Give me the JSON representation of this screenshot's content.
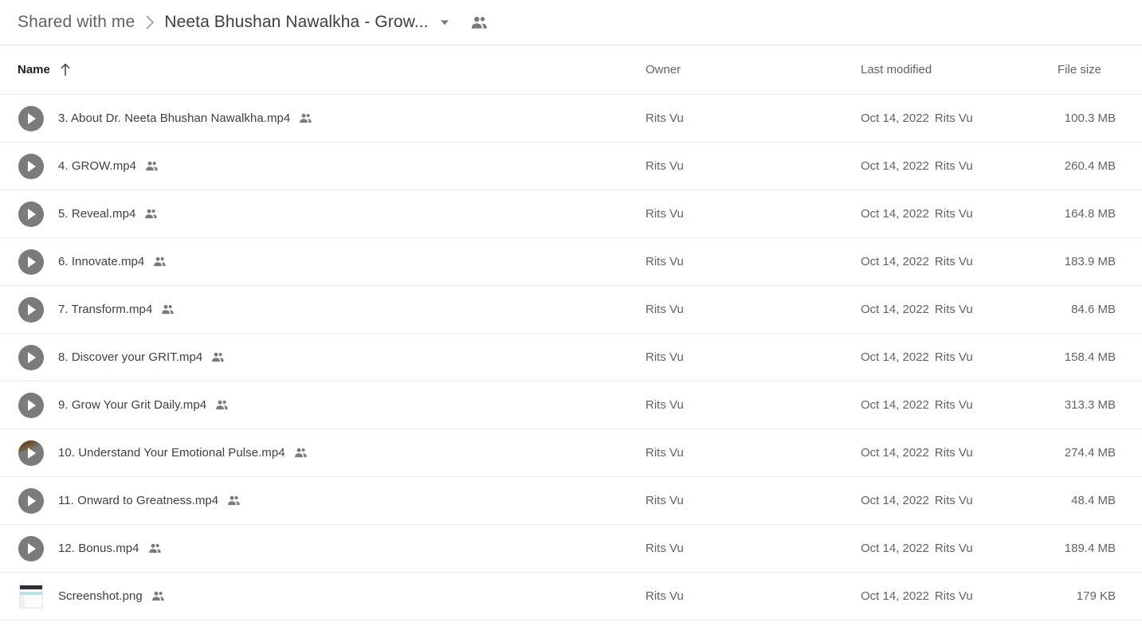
{
  "breadcrumb": {
    "parent": "Shared with me",
    "separator": "›",
    "current": "Neeta Bhushan Nawalkha - Grow...",
    "caret_icon": "chevron-down-icon",
    "people_icon": "people-shared-icon"
  },
  "columns": {
    "name": "Name",
    "sort_arrow": "↑",
    "owner": "Owner",
    "last_modified": "Last modified",
    "file_size": "File size"
  },
  "files": [
    {
      "icon": "video-play-icon",
      "name": "3. About Dr. Neeta Bhushan Nawalkha.mp4",
      "shared_icon": "people-shared-icon",
      "owner": "Rits Vu",
      "modified_date": "Oct 14, 2022",
      "modified_by": "Rits Vu",
      "size": "100.3 MB"
    },
    {
      "icon": "video-play-icon",
      "name": "4. GROW.mp4",
      "shared_icon": "people-shared-icon",
      "owner": "Rits Vu",
      "modified_date": "Oct 14, 2022",
      "modified_by": "Rits Vu",
      "size": "260.4 MB"
    },
    {
      "icon": "video-play-icon",
      "name": "5. Reveal.mp4",
      "shared_icon": "people-shared-icon",
      "owner": "Rits Vu",
      "modified_date": "Oct 14, 2022",
      "modified_by": "Rits Vu",
      "size": "164.8 MB"
    },
    {
      "icon": "video-play-icon",
      "name": "6. Innovate.mp4",
      "shared_icon": "people-shared-icon",
      "owner": "Rits Vu",
      "modified_date": "Oct 14, 2022",
      "modified_by": "Rits Vu",
      "size": "183.9 MB"
    },
    {
      "icon": "video-play-icon",
      "name": "7. Transform.mp4",
      "shared_icon": "people-shared-icon",
      "owner": "Rits Vu",
      "modified_date": "Oct 14, 2022",
      "modified_by": "Rits Vu",
      "size": "84.6 MB"
    },
    {
      "icon": "video-play-icon",
      "name": "8. Discover your GRIT.mp4",
      "shared_icon": "people-shared-icon",
      "owner": "Rits Vu",
      "modified_date": "Oct 14, 2022",
      "modified_by": "Rits Vu",
      "size": "158.4 MB"
    },
    {
      "icon": "video-play-icon",
      "name": "9. Grow Your Grit Daily.mp4",
      "shared_icon": "people-shared-icon",
      "owner": "Rits Vu",
      "modified_date": "Oct 14, 2022",
      "modified_by": "Rits Vu",
      "size": "313.3 MB"
    },
    {
      "icon": "video-play-icon-with-thumbnail",
      "name": "10. Understand Your Emotional Pulse.mp4",
      "shared_icon": "people-shared-icon",
      "owner": "Rits Vu",
      "modified_date": "Oct 14, 2022",
      "modified_by": "Rits Vu",
      "size": "274.4 MB"
    },
    {
      "icon": "video-play-icon",
      "name": "11. Onward to Greatness.mp4",
      "shared_icon": "people-shared-icon",
      "owner": "Rits Vu",
      "modified_date": "Oct 14, 2022",
      "modified_by": "Rits Vu",
      "size": "48.4 MB"
    },
    {
      "icon": "video-play-icon",
      "name": "12. Bonus.mp4",
      "shared_icon": "people-shared-icon",
      "owner": "Rits Vu",
      "modified_date": "Oct 14, 2022",
      "modified_by": "Rits Vu",
      "size": "189.4 MB"
    },
    {
      "icon": "image-thumbnail-icon",
      "name": "Screenshot.png",
      "shared_icon": "people-shared-icon",
      "owner": "Rits Vu",
      "modified_date": "Oct 14, 2022",
      "modified_by": "Rits Vu",
      "size": "179 KB"
    }
  ],
  "colors": {
    "text_primary": "#3c4043",
    "text_secondary": "#5f6368",
    "divider": "#e8eaed",
    "icon_gray": "#7b7b7b"
  }
}
